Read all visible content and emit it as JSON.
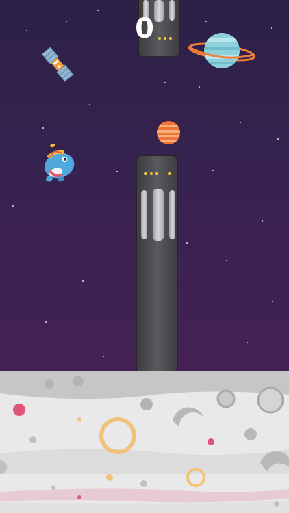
{
  "game": {
    "score": "0"
  },
  "colors": {
    "sky_top": "#2c2147",
    "sky_bottom": "#4d1f5b",
    "pillar": "#4a4a4d",
    "ground": "#e6e6e6",
    "light": "#f4c542"
  },
  "sprites": {
    "player": "blue-creature-with-propeller-hat",
    "satellite": "satellite-icon",
    "ringed_planet": "ringed-planet-icon",
    "small_planet": "orange-planet-icon"
  }
}
